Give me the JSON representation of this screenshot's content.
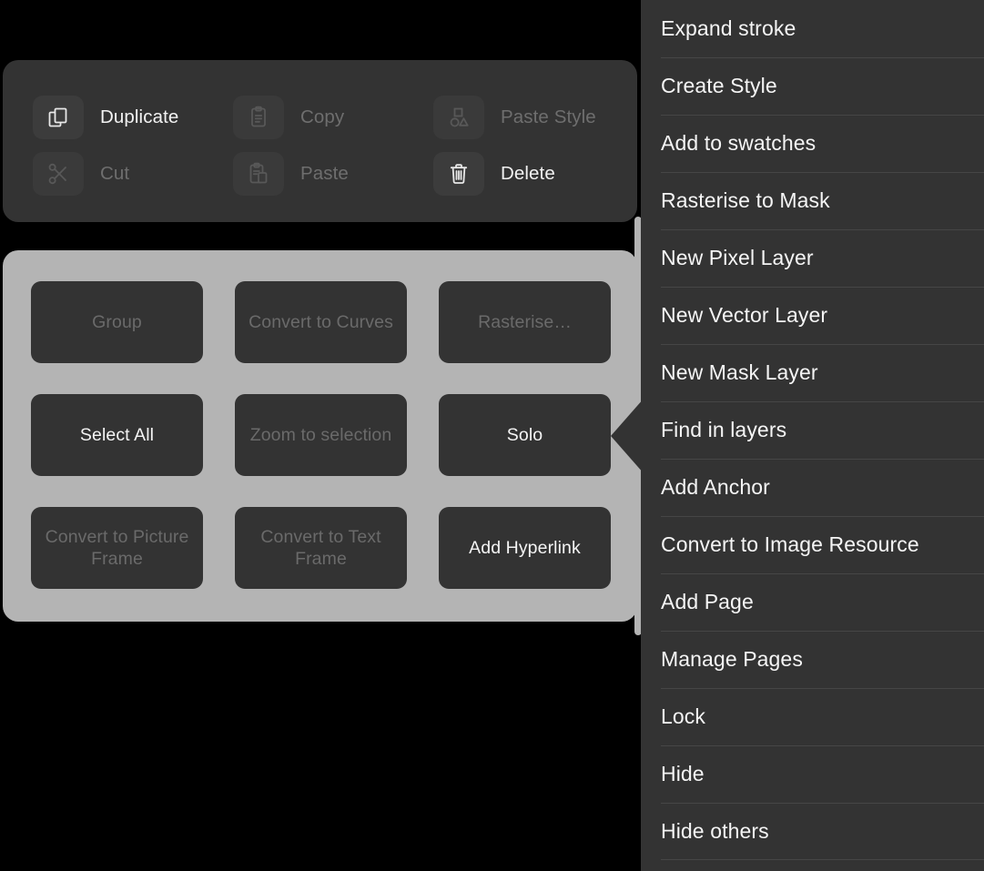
{
  "clipboard_panel": {
    "name": "Clipboard commands",
    "commands": [
      {
        "label": "Duplicate",
        "icon": "duplicate-icon",
        "enabled": true
      },
      {
        "label": "Copy",
        "icon": "copy-icon",
        "enabled": false
      },
      {
        "label": "Paste Style",
        "icon": "paste-style-icon",
        "enabled": false
      },
      {
        "label": "Cut",
        "icon": "scissors-icon",
        "enabled": false
      },
      {
        "label": "Paste",
        "icon": "paste-icon",
        "enabled": false
      },
      {
        "label": "Delete",
        "icon": "trash-icon",
        "enabled": true
      }
    ]
  },
  "actions_panel": {
    "name": "Object actions",
    "tiles": [
      {
        "label": "Group",
        "enabled": false
      },
      {
        "label": "Convert to Curves",
        "enabled": false
      },
      {
        "label": "Rasterise…",
        "enabled": false
      },
      {
        "label": "Select All",
        "enabled": true
      },
      {
        "label": "Zoom to selection",
        "enabled": false
      },
      {
        "label": "Solo",
        "enabled": true
      },
      {
        "label": "Convert to Picture Frame",
        "enabled": false
      },
      {
        "label": "Convert to Text Frame",
        "enabled": false
      },
      {
        "label": "Add Hyperlink",
        "enabled": true
      }
    ]
  },
  "context_menu": {
    "name": "Layer context menu",
    "items": [
      {
        "label": "Expand stroke"
      },
      {
        "label": "Create Style"
      },
      {
        "label": "Add to swatches"
      },
      {
        "label": "Rasterise to Mask"
      },
      {
        "label": "New Pixel Layer"
      },
      {
        "label": "New Vector Layer"
      },
      {
        "label": "New Mask Layer"
      },
      {
        "label": "Find in layers"
      },
      {
        "label": "Add Anchor"
      },
      {
        "label": "Convert to Image Resource"
      },
      {
        "label": "Add Page"
      },
      {
        "label": "Manage Pages"
      },
      {
        "label": "Lock"
      },
      {
        "label": "Hide"
      },
      {
        "label": "Hide others"
      }
    ]
  },
  "colors": {
    "background": "#000000",
    "panel_dark": "#333333",
    "panel_grey": "#b4b4b4",
    "icon_tile": "#3c3c3c",
    "text_enabled": "#f4f4f4",
    "text_disabled": "#6a6a6a",
    "separator": "#464646"
  }
}
